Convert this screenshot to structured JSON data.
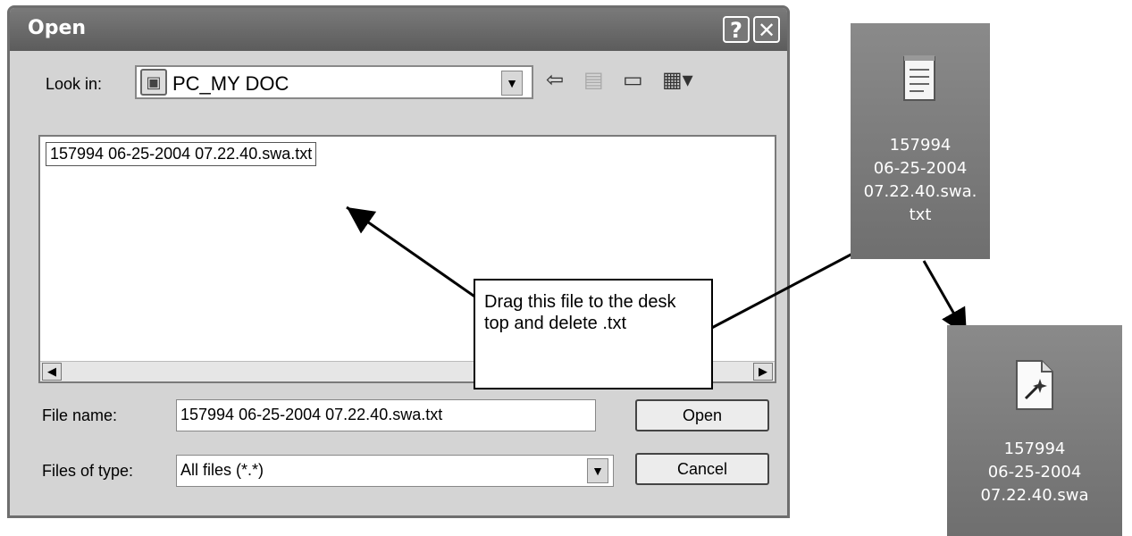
{
  "dialog": {
    "title": "Open",
    "help_icon": "?",
    "close_icon": "✕",
    "look_in": {
      "label": "Look in:",
      "value": "PC_MY DOC"
    },
    "files": [
      "157994 06-25-2004 07.22.40.swa.txt"
    ],
    "file_name": {
      "label": "File name:",
      "value": "157994 06-25-2004 07.22.40.swa.txt"
    },
    "file_type": {
      "label": "Files of type:",
      "value": "All files (*.*)"
    },
    "open_button": "Open",
    "cancel_button": "Cancel"
  },
  "annotation": "Drag this file to the desk top and delete .txt",
  "desktop_icons": [
    {
      "icon": "notepad-icon",
      "name_lines": [
        "157994",
        "06-25-2004",
        "07.22.40.swa.",
        "txt"
      ]
    },
    {
      "icon": "unknown-file-icon",
      "name_lines": [
        "157994",
        "06-25-2004",
        "07.22.40.swa"
      ]
    }
  ]
}
